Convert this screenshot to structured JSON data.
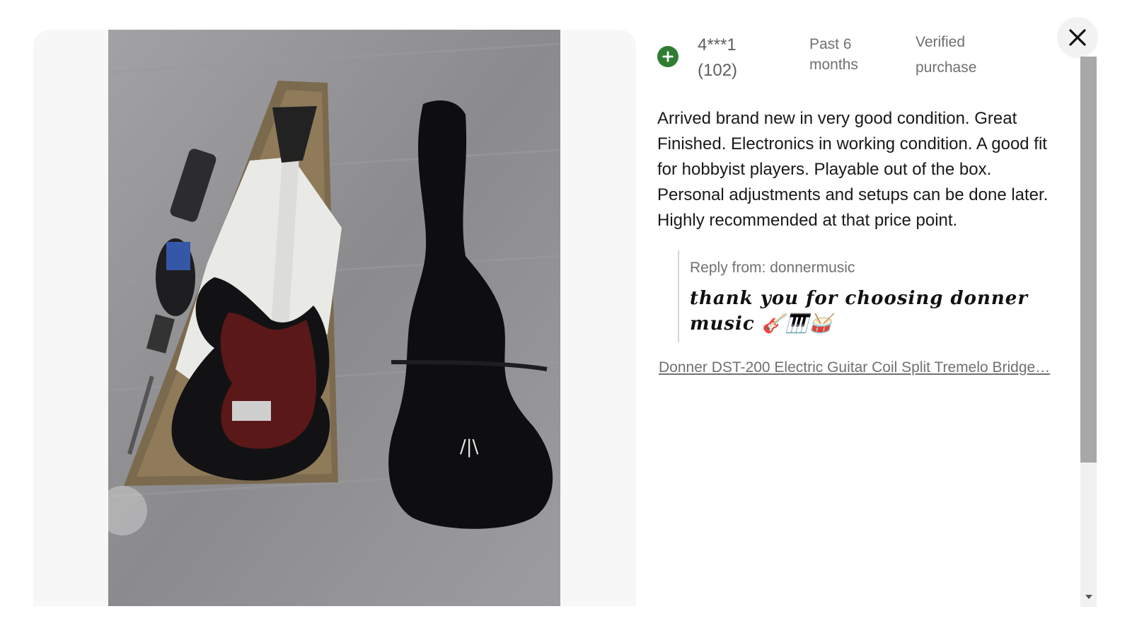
{
  "review": {
    "reviewer_name": "4***1",
    "reviewer_count": "(102)",
    "time_line1": "Past 6",
    "time_line2": "months",
    "verified_line1": "Verified",
    "verified_line2": "purchase",
    "body": "Arrived brand new in very good condition. Great Finished. Electronics in working condition. A good fit for hobbyist players. Playable out of the box. Personal adjustments and setups can be done later. Highly recommended at that price point.",
    "reply_label": "Reply from: donnermusic",
    "reply_text": "thank you for choosing donner music 🎸🎹🥁",
    "product_link": "Donner DST-200 Electric Guitar Coil Split Tremelo Bridge…"
  },
  "colors": {
    "avatar": "#2f7d32",
    "text": "#191919",
    "muted": "#707070",
    "scroll_thumb": "#a8a8a8"
  },
  "icons": {
    "avatar": "plus-circle-icon",
    "close": "close-icon",
    "scroll_down": "caret-down-icon"
  }
}
